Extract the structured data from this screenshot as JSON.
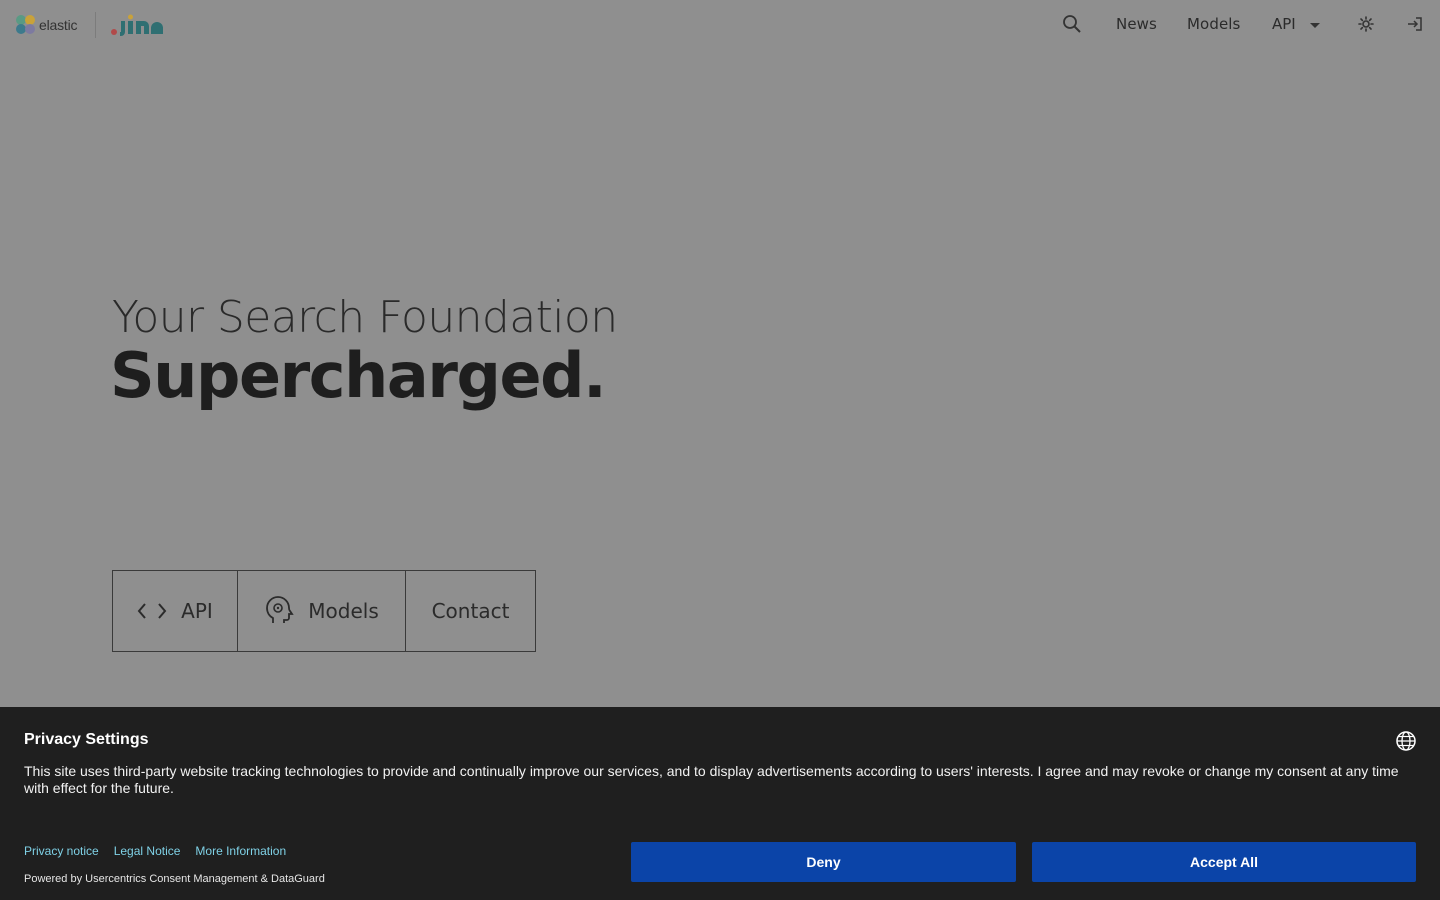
{
  "header": {
    "elastic_word": "elastic",
    "nav": {
      "news": "News",
      "models": "Models",
      "api": "API"
    }
  },
  "hero": {
    "line1": "Your Search Foundation",
    "line2": "Supercharged.",
    "cta": {
      "api": "API",
      "models": "Models",
      "contact": "Contact"
    }
  },
  "consent": {
    "title": "Privacy Settings",
    "text": "This site uses third-party website tracking technologies to provide and continually improve our services, and to display advertisements according to users' interests. I agree and may revoke or change my consent at any time with effect for the future.",
    "links": {
      "privacy": "Privacy notice",
      "legal": "Legal Notice",
      "more": "More Information"
    },
    "powered": "Powered by Usercentrics Consent Management & DataGuard",
    "deny": "Deny",
    "accept": "Accept All"
  },
  "colors": {
    "overlay_bg": "#8f8f8f",
    "banner_bg": "#1f1f1f",
    "button_blue": "#0b44a8",
    "link_cyan": "#7fd1e6"
  },
  "icons": {
    "search": "search-icon",
    "settings": "gear-icon",
    "login": "login-icon",
    "code": "code-icon",
    "models": "brain-head-icon",
    "language": "globe-icon"
  }
}
